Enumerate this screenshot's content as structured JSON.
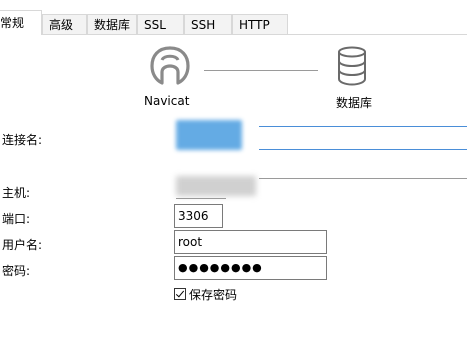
{
  "tabs": [
    {
      "label": "常规"
    },
    {
      "label": "高级"
    },
    {
      "label": "数据库"
    },
    {
      "label": "SSL"
    },
    {
      "label": "SSH"
    },
    {
      "label": "HTTP"
    }
  ],
  "diagram": {
    "left_label": "Navicat",
    "right_label": "数据库"
  },
  "form": {
    "connection_name_label": "连接名:",
    "host_label": "主机:",
    "port_label": "端口:",
    "port_value": "3306",
    "username_label": "用户名:",
    "username_value": "root",
    "password_label": "密码:",
    "password_value": "●●●●●●●●",
    "save_password_label": "保存密码",
    "save_password_checked": true
  },
  "colors": {
    "accent": "#4a9de0",
    "border": "#7a7a7a"
  }
}
